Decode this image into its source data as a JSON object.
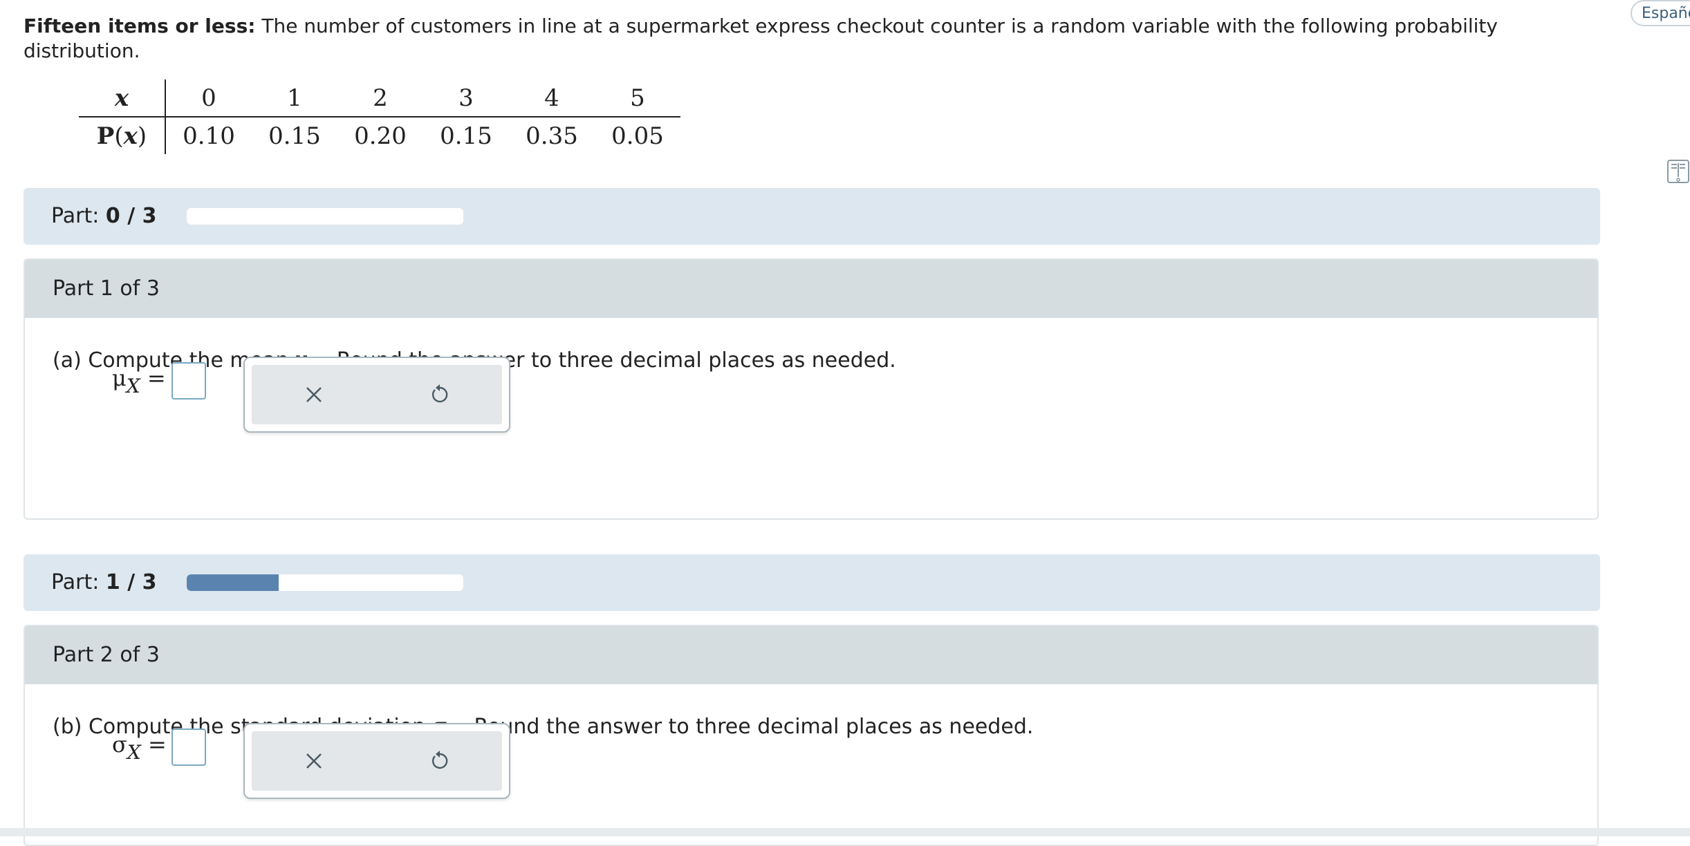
{
  "problem": {
    "title": "Fifteen items or less:",
    "text": " The number of customers in line at a supermarket express checkout counter is a random variable with the following probability distribution."
  },
  "language_button": "Español",
  "distribution": {
    "x_header": "x",
    "p_header_prefix": "P",
    "p_header_paren_open": "(",
    "p_header_x": "x",
    "p_header_paren_close": ")",
    "x_values": [
      "0",
      "1",
      "2",
      "3",
      "4",
      "5"
    ],
    "p_values": [
      "0.10",
      "0.15",
      "0.20",
      "0.15",
      "0.35",
      "0.05"
    ]
  },
  "progress1": {
    "label": "Part:",
    "value": "0 / 3",
    "fraction": 0.0
  },
  "part1": {
    "header": "Part 1 of 3",
    "question_prefix": "(a) Compute the mean ",
    "symbol": "μ",
    "subscript": "X",
    "question_suffix": ". Round the answer to three decimal places as needed.",
    "answer_symbol": "μ",
    "answer_sub": "X",
    "equals": "=",
    "answer_value": ""
  },
  "progress2": {
    "label": "Part:",
    "value": "1 / 3",
    "fraction": 0.333
  },
  "part2": {
    "header": "Part 2 of 3",
    "question_prefix": "(b) Compute the standard deviation ",
    "symbol": "σ",
    "subscript": "X",
    "question_suffix": ". Round the answer to three decimal places as needed.",
    "answer_symbol": "σ",
    "answer_sub": "X",
    "equals": "=",
    "answer_value": ""
  },
  "icons": {
    "clear": "close-icon",
    "undo": "undo-icon",
    "side": "book-icon"
  },
  "colors": {
    "progress_fill": "#5b83b0",
    "band_bg": "#dde7ef",
    "header_bg": "#d5dde1"
  }
}
